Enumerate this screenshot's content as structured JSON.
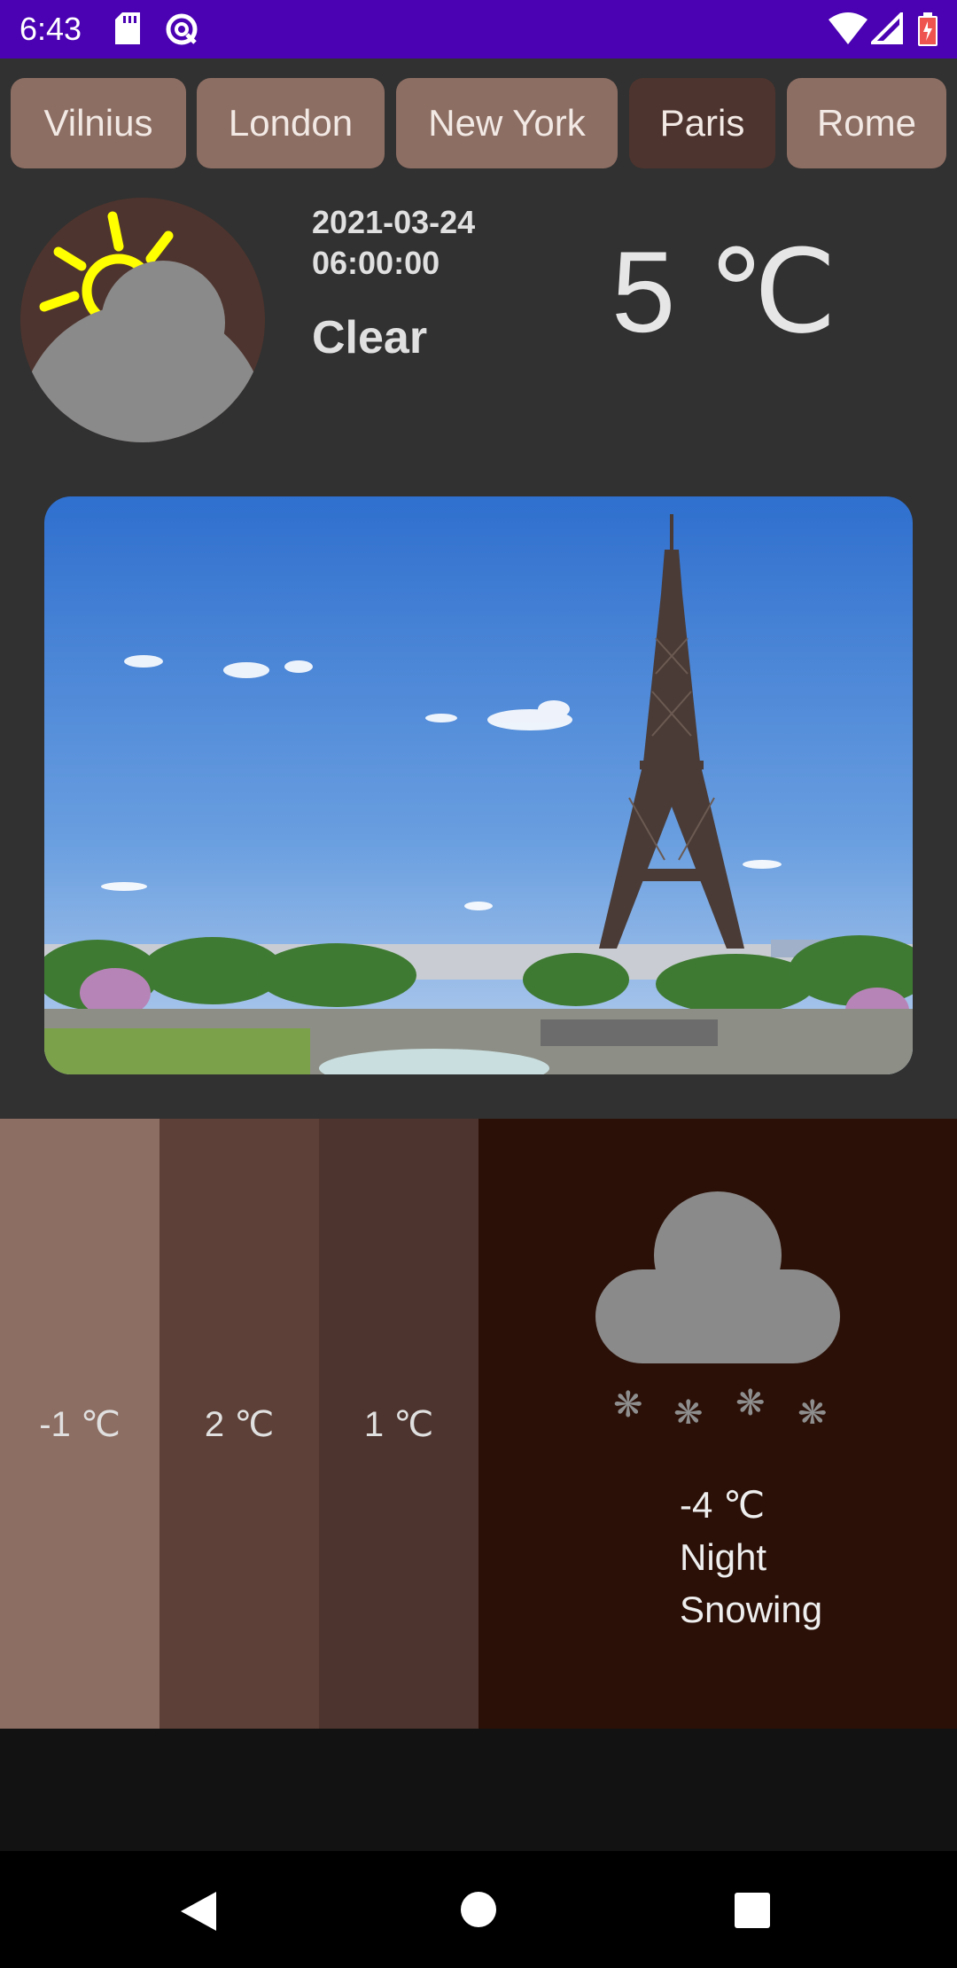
{
  "status_bar": {
    "time": "6:43",
    "icons": [
      "sd-card-icon",
      "data-saver-icon",
      "wifi-icon",
      "cell-signal-icon",
      "battery-charging-icon"
    ],
    "background": "#4a02b3"
  },
  "cities": [
    {
      "label": "Vilnius",
      "active": false
    },
    {
      "label": "London",
      "active": false
    },
    {
      "label": "New York",
      "active": false
    },
    {
      "label": "Paris",
      "active": true
    },
    {
      "label": "Rome",
      "active": false
    }
  ],
  "current": {
    "icon": "partly-cloudy-icon",
    "date": "2021-03-24",
    "time": "06:00:00",
    "condition": "Clear",
    "temperature": "5 ℃"
  },
  "photo": {
    "subject": "eiffel-tower-photo"
  },
  "forecast": {
    "cards": [
      {
        "temp": "-1 ℃",
        "color": "#8d6e63"
      },
      {
        "temp": "2 ℃",
        "color": "#5d4037"
      },
      {
        "temp": "1 ℃",
        "color": "#4e342e"
      }
    ],
    "highlight": {
      "icon": "snow-cloud-icon",
      "temp": "-4 ℃",
      "period": "Night",
      "condition": "Snowing",
      "color": "#2b1007"
    }
  },
  "colors": {
    "app_background": "#313131",
    "tab": "#8d6e63",
    "tab_active": "#4e342e"
  }
}
